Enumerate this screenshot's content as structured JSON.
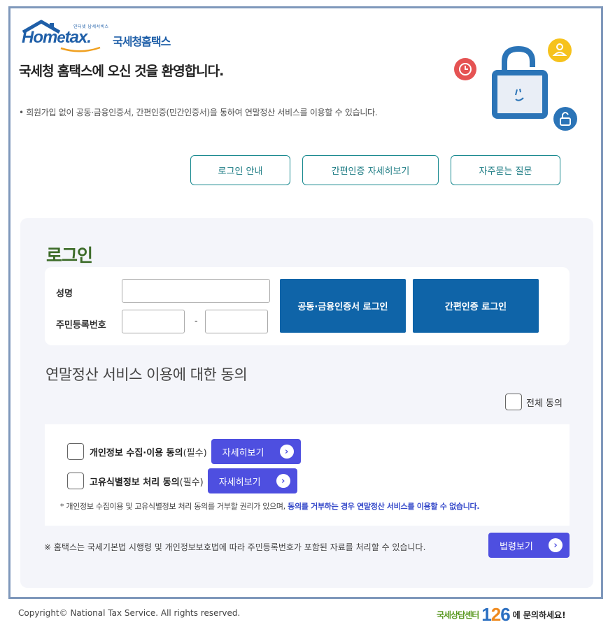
{
  "header": {
    "logo_small": "인터넷 납세서비스",
    "logo_brand_1": "Hom",
    "logo_brand_e": "e",
    "logo_brand_2": "tax.",
    "logo_korean": "국세청홈택스",
    "welcome": "국세청 홈택스에 오신 것을 환영합니다.",
    "notice": "• 회원가입 없이 공동·금융인증서, 간편인증(민간인증서)을 통하여 연말정산 서비스를 이용할 수 있습니다."
  },
  "top_buttons": {
    "login_guide": "로그인 안내",
    "simple_auth_detail": "간편인증 자세히보기",
    "faq": "자주묻는 질문"
  },
  "login": {
    "title": "로그인",
    "name_label": "성명",
    "rrn_label": "주민등록번호",
    "rrn_dash": "-",
    "cert_login_button": "공동·금융인증서 로그인",
    "simple_login_button": "간편인증 로그인"
  },
  "agreement": {
    "title": "연말정산 서비스 이용에 대한 동의",
    "all_agree": "전체 동의",
    "items": [
      {
        "label": "개인정보 수집·이용 동의",
        "required": "(필수)",
        "detail": "자세히보기"
      },
      {
        "label": "고유식별정보 처리 동의",
        "required": "(필수)",
        "detail": "자세히보기"
      }
    ],
    "note_plain": "* 개인정보 수집이용 및 고유식별정보 처리 동의를 거부할 권리가 있으며, ",
    "note_bold": "동의를 거부하는 경우 연말정산 서비스를 이용할 수 없습니다.",
    "law_note": "※ 홈택스는 국세기본법 시행령 및 개인정보보호법에 따라 주민등록번호가 포함된 자료를 처리할 수 있습니다.",
    "law_button": "법령보기"
  },
  "footer": {
    "copyright": "Copyright© National Tax Service. All rights reserved.",
    "call_label": "국세상담센터",
    "call_num_1": "1",
    "call_num_2": "2",
    "call_num_3": "6",
    "call_suffix": "에 문의하세요!"
  },
  "colors": {
    "frame_border": "#7f98bb",
    "primary_blue": "#0f64a8",
    "accent_violet": "#4e4fe0",
    "teal_outline": "#1a8a90",
    "login_green": "#3c6b28"
  }
}
